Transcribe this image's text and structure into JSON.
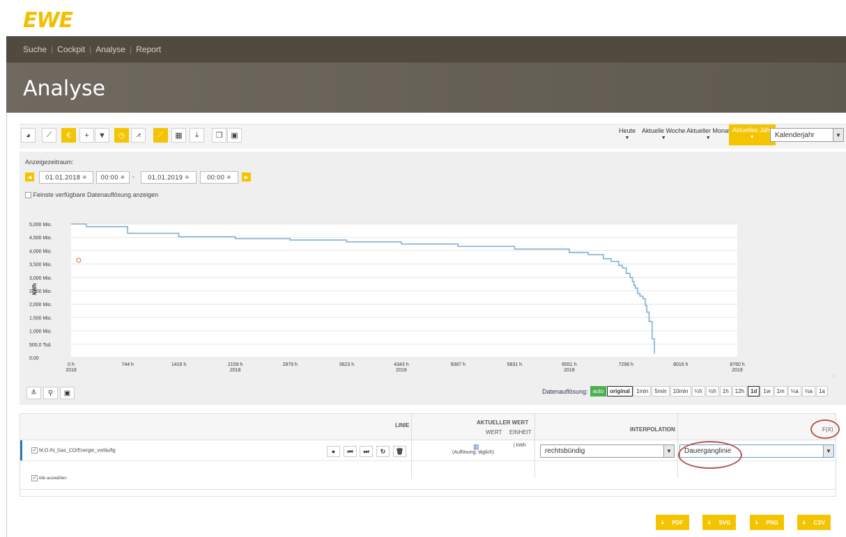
{
  "logo": "EWE",
  "nav": {
    "items": [
      "Suche",
      "Cockpit",
      "Analyse",
      "Report"
    ]
  },
  "page_title": "Analyse",
  "toolbar": {
    "buttons": [
      "palette-icon",
      "line-chart-icon",
      "currency-icon",
      "plus-icon",
      "filter-icon",
      "clock-icon",
      "area-chart-icon",
      "line-chart-icon",
      "table-icon",
      "download-icon",
      "copy-icon",
      "save-icon"
    ],
    "periods": [
      "Heute",
      "Aktuelle Woche",
      "Aktueller Monat",
      "Aktuelles Jahr"
    ],
    "active_period": "Aktuelles Jahr",
    "period_type": "Kalenderjahr",
    "accent_color": "#f5c400"
  },
  "range": {
    "label": "Anzeigezeitraum:",
    "from_date": "01.01.2018",
    "from_time": "00:00",
    "sep": "-",
    "to_date": "01.01.2019",
    "to_time": "00:00",
    "finest_label": "Feinste verfügbare Datenauflösung anzeigen"
  },
  "chart_data": {
    "type": "line",
    "ylabel": "kWh",
    "yticks": [
      "5,000 Mio.",
      "4,500 Mio.",
      "4,000 Mio.",
      "3,500 Mio.",
      "3,000 Mio.",
      "2,500 Mio.",
      "2,000 Mio.",
      "1,500 Mio.",
      "1,000 Mio.",
      "500,0 Tsd.",
      "0,00"
    ],
    "xticks": [
      {
        "label": "0 h",
        "sub": "2018"
      },
      {
        "label": "744 h",
        "sub": ""
      },
      {
        "label": "1416 h",
        "sub": ""
      },
      {
        "label": "2159 h",
        "sub": "2018"
      },
      {
        "label": "2879 h",
        "sub": ""
      },
      {
        "label": "3623 h",
        "sub": ""
      },
      {
        "label": "4343 h",
        "sub": "2018"
      },
      {
        "label": "5087 h",
        "sub": ""
      },
      {
        "label": "5831 h",
        "sub": ""
      },
      {
        "label": "6551 h",
        "sub": "2018"
      },
      {
        "label": "7296 h",
        "sub": ""
      },
      {
        "label": "8016 h",
        "sub": ""
      },
      {
        "label": "8760 h",
        "sub": "2019"
      }
    ],
    "ylim": [
      0,
      5000000
    ],
    "grid": true,
    "series": [
      {
        "color": "#7fb0d8",
        "x": [
          0,
          200,
          744,
          1416,
          2159,
          2879,
          3623,
          4343,
          5087,
          5831,
          6551,
          6800,
          7000,
          7100,
          7200,
          7250,
          7300,
          7350,
          7380,
          7400,
          7420,
          7450,
          7480,
          7520,
          7550,
          7570,
          7600,
          7640,
          7670
        ],
        "y": [
          5000000,
          4900000,
          4650000,
          4520000,
          4450000,
          4400000,
          4330000,
          4250000,
          4160000,
          4060000,
          3930000,
          3850000,
          3700000,
          3600000,
          3450000,
          3350000,
          3150000,
          3000000,
          2850000,
          2700000,
          2600000,
          2400000,
          2300000,
          2200000,
          1950000,
          1700000,
          1350000,
          700000,
          150000
        ]
      }
    ],
    "marker": {
      "x": 100,
      "y": 3640000,
      "color": "#e8805a"
    }
  },
  "resolution": {
    "label": "Datenauflösung:",
    "options": [
      "auto",
      "original",
      "1min",
      "5min",
      "10min",
      "¼h",
      "½h",
      "1h",
      "12h",
      "1d",
      "1w",
      "1m",
      "¼a",
      "½a",
      "1a"
    ],
    "selected": "1d"
  },
  "table": {
    "headers": {
      "linie": "LINIE",
      "aktueller_wert": "AKTUELLER WERT",
      "wert": "WERT",
      "einheit": "EINHEIT",
      "interpolation": "INTERPOLATION",
      "fx": "F(X)"
    },
    "row": {
      "name": "M.O.IN_Gas_CO/Energie_vorläufig",
      "value_note": "(Auflösung: täglich)",
      "unit": "kWh",
      "interpolation": "rechtsbündig",
      "function": "Dauerganglinie"
    },
    "select_all": "Alle auswählen"
  },
  "exports": [
    "PDF",
    "SVG",
    "PNG",
    "CSV"
  ]
}
